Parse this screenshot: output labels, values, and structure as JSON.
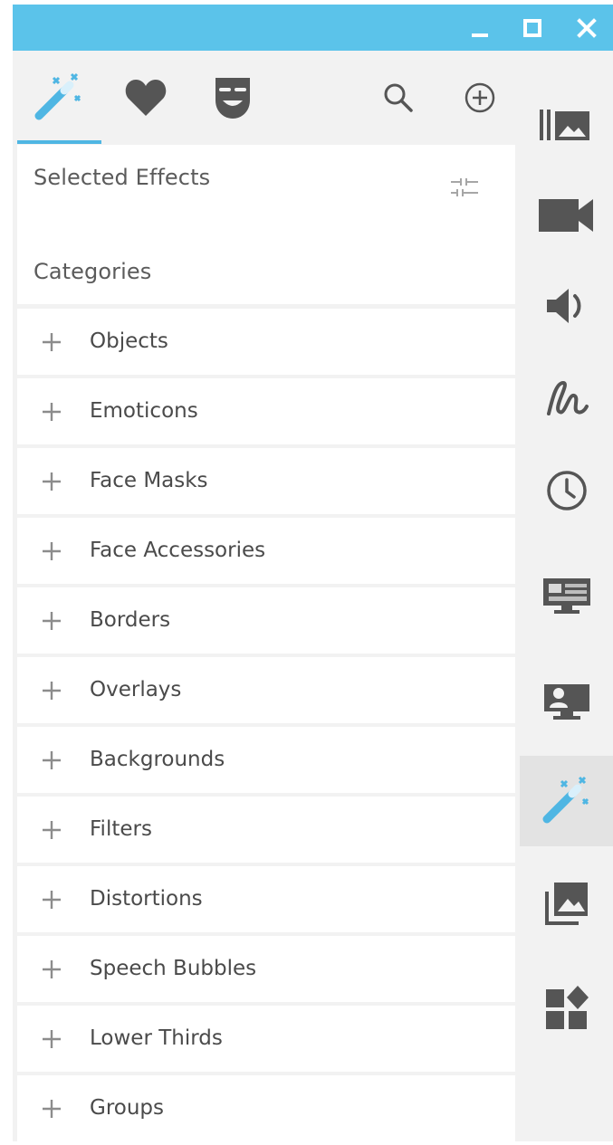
{
  "titlebar": {
    "minimize_icon": "minimize-icon",
    "maximize_icon": "maximize-icon",
    "close_icon": "close-icon"
  },
  "tabs": [
    {
      "icon": "magic-wand-icon",
      "active": true
    },
    {
      "icon": "heart-icon",
      "active": false
    },
    {
      "icon": "theater-mask-icon",
      "active": false
    }
  ],
  "toolbar": {
    "search_icon": "search-icon",
    "add_icon": "add-circle-icon"
  },
  "selected_effects": {
    "title": "Selected Effects",
    "filter_icon": "filter-sliders-icon"
  },
  "categories": {
    "title": "Categories",
    "items": [
      {
        "label": "Objects"
      },
      {
        "label": "Emoticons"
      },
      {
        "label": "Face Masks"
      },
      {
        "label": "Face Accessories"
      },
      {
        "label": "Borders"
      },
      {
        "label": "Overlays"
      },
      {
        "label": "Backgrounds"
      },
      {
        "label": "Filters"
      },
      {
        "label": "Distortions"
      },
      {
        "label": "Speech Bubbles"
      },
      {
        "label": "Lower Thirds"
      },
      {
        "label": "Groups"
      }
    ]
  },
  "sidebar": {
    "items": [
      {
        "icon": "media-library-icon"
      },
      {
        "icon": "video-camera-icon"
      },
      {
        "icon": "speaker-icon"
      },
      {
        "icon": "doodle-icon"
      },
      {
        "icon": "clock-icon"
      },
      {
        "icon": "screen-record-icon"
      },
      {
        "icon": "webcam-presenter-icon"
      },
      {
        "icon": "magic-wand-icon",
        "active": true
      },
      {
        "icon": "image-stack-icon"
      },
      {
        "icon": "widgets-icon"
      }
    ]
  },
  "colors": {
    "titlebar": "#5bc3ea",
    "accent": "#4fb6e3",
    "icon_gray": "#555555",
    "panel_bg": "#f2f2f2",
    "active_sidebar": "#e3e3e3"
  }
}
